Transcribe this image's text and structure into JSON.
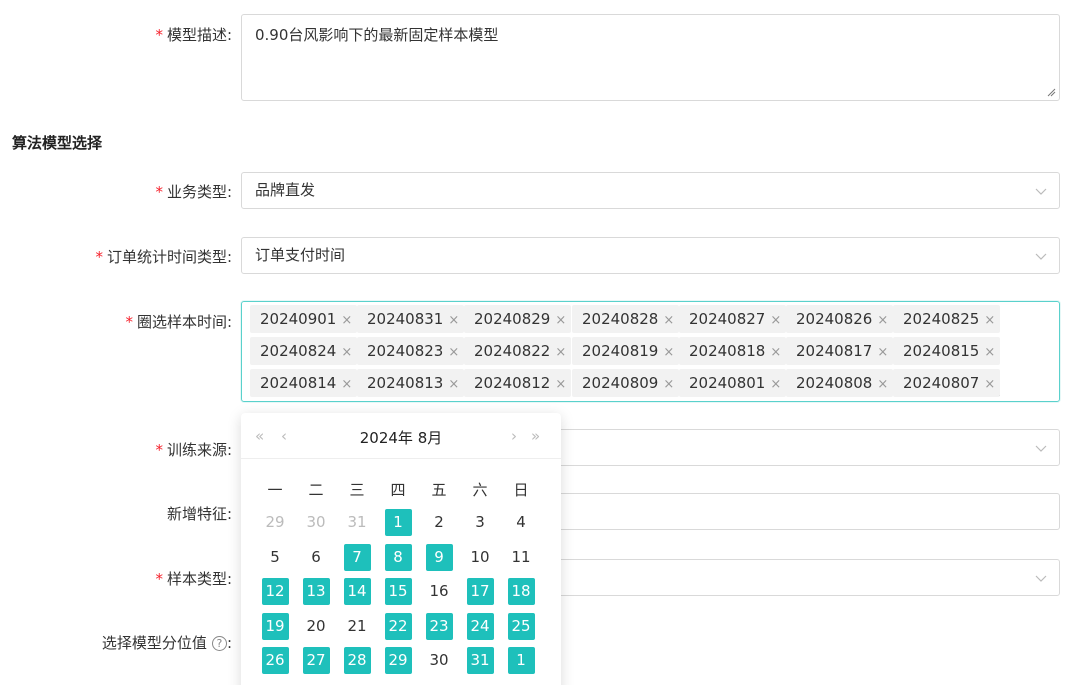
{
  "form": {
    "desc_label": "模型描述:",
    "desc_value": "0.90台风影响下的最新固定样本模型",
    "section_title": "算法模型选择",
    "biz_label": "业务类型:",
    "biz_value": "品牌直发",
    "order_time_label": "订单统计时间类型:",
    "order_time_value": "订单支付时间",
    "sample_time_label": "圈选样本时间:",
    "train_src_label": "训练来源:",
    "new_feat_label": "新增特征:",
    "sample_type_label": "样本类型:",
    "quantile_label": "选择模型分位值",
    "quantile_help": "?",
    "required_mark": "*",
    "colon_tail": ":"
  },
  "tags": [
    "20240901",
    "20240831",
    "20240829",
    "20240828",
    "20240827",
    "20240826",
    "20240825",
    "20240824",
    "20240823",
    "20240822",
    "20240819",
    "20240818",
    "20240817",
    "20240815",
    "20240814",
    "20240813",
    "20240812",
    "20240809",
    "20240801",
    "20240808",
    "20240807"
  ],
  "tag_close": "×",
  "calendar": {
    "title": "2024年  8月",
    "prev_year": "«",
    "prev_month": "‹",
    "next_month": "›",
    "next_year": "»",
    "weekdays": [
      "一",
      "二",
      "三",
      "四",
      "五",
      "六",
      "日"
    ],
    "days": [
      [
        {
          "d": "29",
          "s": "muted"
        },
        {
          "d": "30",
          "s": "muted"
        },
        {
          "d": "31",
          "s": "muted"
        },
        {
          "d": "1",
          "s": "sel"
        },
        {
          "d": "2",
          "s": ""
        },
        {
          "d": "3",
          "s": ""
        },
        {
          "d": "4",
          "s": ""
        }
      ],
      [
        {
          "d": "5",
          "s": ""
        },
        {
          "d": "6",
          "s": ""
        },
        {
          "d": "7",
          "s": "sel"
        },
        {
          "d": "8",
          "s": "sel"
        },
        {
          "d": "9",
          "s": "sel"
        },
        {
          "d": "10",
          "s": ""
        },
        {
          "d": "11",
          "s": ""
        }
      ],
      [
        {
          "d": "12",
          "s": "sel"
        },
        {
          "d": "13",
          "s": "sel"
        },
        {
          "d": "14",
          "s": "sel"
        },
        {
          "d": "15",
          "s": "sel"
        },
        {
          "d": "16",
          "s": ""
        },
        {
          "d": "17",
          "s": "sel"
        },
        {
          "d": "18",
          "s": "sel"
        }
      ],
      [
        {
          "d": "19",
          "s": "sel"
        },
        {
          "d": "20",
          "s": ""
        },
        {
          "d": "21",
          "s": ""
        },
        {
          "d": "22",
          "s": "sel"
        },
        {
          "d": "23",
          "s": "sel"
        },
        {
          "d": "24",
          "s": "sel"
        },
        {
          "d": "25",
          "s": "sel"
        }
      ],
      [
        {
          "d": "26",
          "s": "sel"
        },
        {
          "d": "27",
          "s": "sel"
        },
        {
          "d": "28",
          "s": "sel"
        },
        {
          "d": "29",
          "s": "sel"
        },
        {
          "d": "30",
          "s": ""
        },
        {
          "d": "31",
          "s": "sel"
        },
        {
          "d": "1",
          "s": "sel"
        }
      ]
    ]
  },
  "colors": {
    "accent": "#1ec0bb",
    "required": "#f5222d",
    "focus_border": "#5ad1cc"
  },
  "icons": {
    "dropdown": "chevron-down-icon",
    "help": "question-circle-icon"
  }
}
